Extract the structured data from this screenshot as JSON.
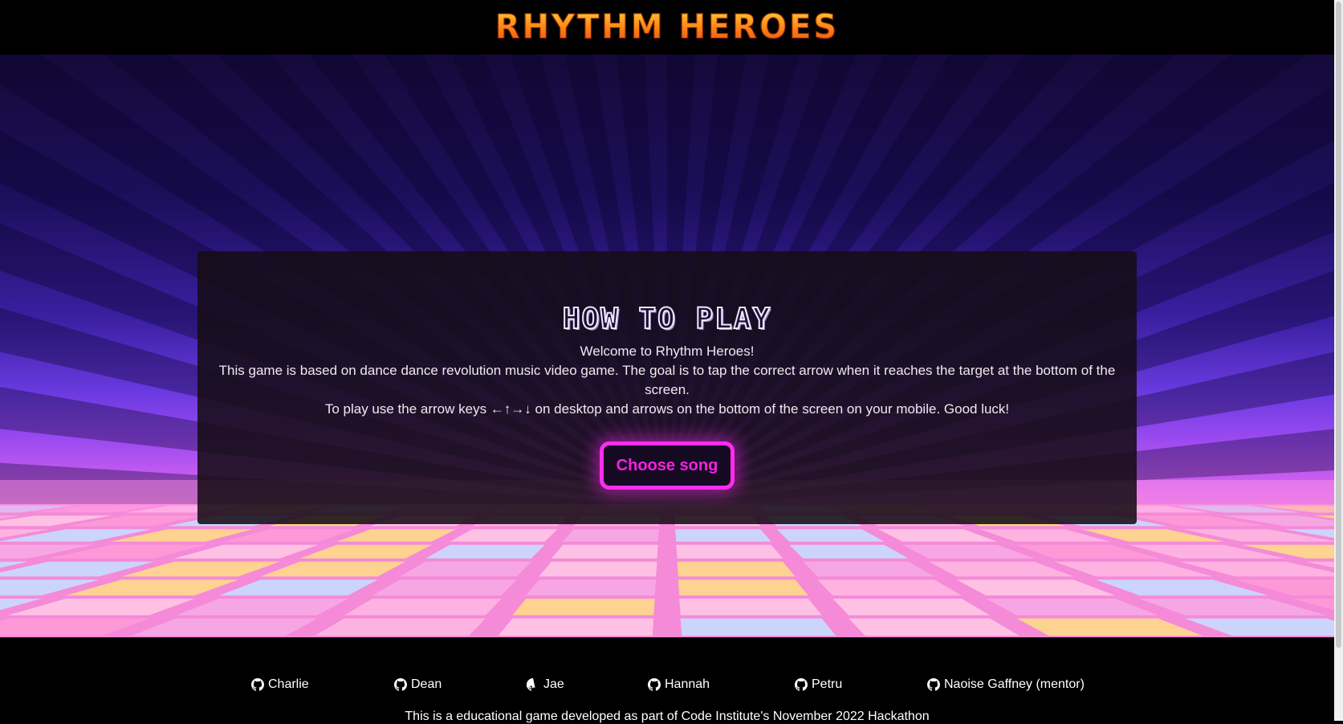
{
  "header": {
    "title": "RHYTHM HEROES"
  },
  "how_to_play": {
    "title": "HOW TO PLAY",
    "welcome": "Welcome to Rhythm Heroes!",
    "line1": "This game is based on dance dance revolution music video game. The goal is to tap the correct arrow when it reaches the target at the bottom of the screen.",
    "line2": "To play use the arrow keys ←↑→↓ on desktop and arrows on the bottom of the screen on your mobile. Good luck!",
    "button": "Choose song"
  },
  "footer": {
    "contributors": [
      {
        "name": "Charlie",
        "icon": "github-icon"
      },
      {
        "name": "Dean",
        "icon": "github-icon"
      },
      {
        "name": "Jae",
        "icon": "github-icon"
      },
      {
        "name": "Hannah",
        "icon": "github-icon"
      },
      {
        "name": "Petru",
        "icon": "github-icon"
      },
      {
        "name": "Naoise Gaffney (mentor)",
        "icon": "github-icon"
      }
    ],
    "note": "This is a educational game developed as part of Code Institute's November 2022 Hackathon"
  },
  "colors": {
    "accent": "#ff2cf0",
    "logo": "#ff8c1a",
    "background": "#000000"
  }
}
